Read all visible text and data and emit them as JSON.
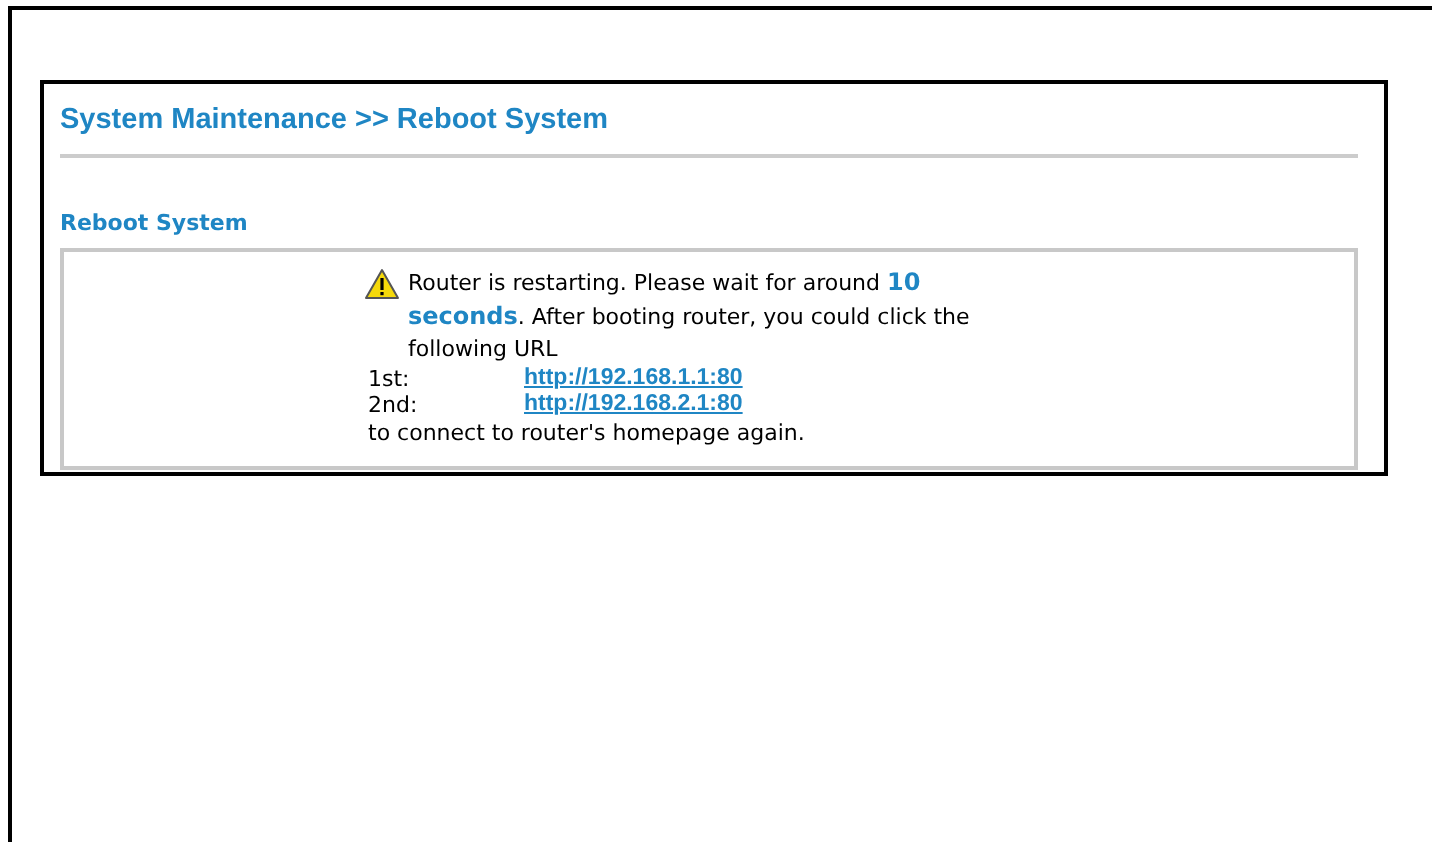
{
  "page_title": "System Maintenance >> Reboot System",
  "section_title": "Reboot System",
  "message": "Router is restarting. Please wait for around **10 seconds**. After booting router, you could click the following URL",
  "urls": [
    {
      "label": "1st:",
      "url": "http://192.168.1.1:80"
    },
    {
      "label": "2nd:",
      "url": "http://192.168.2.1:80"
    }
  ],
  "closing": "to connect to router's homepage again."
}
